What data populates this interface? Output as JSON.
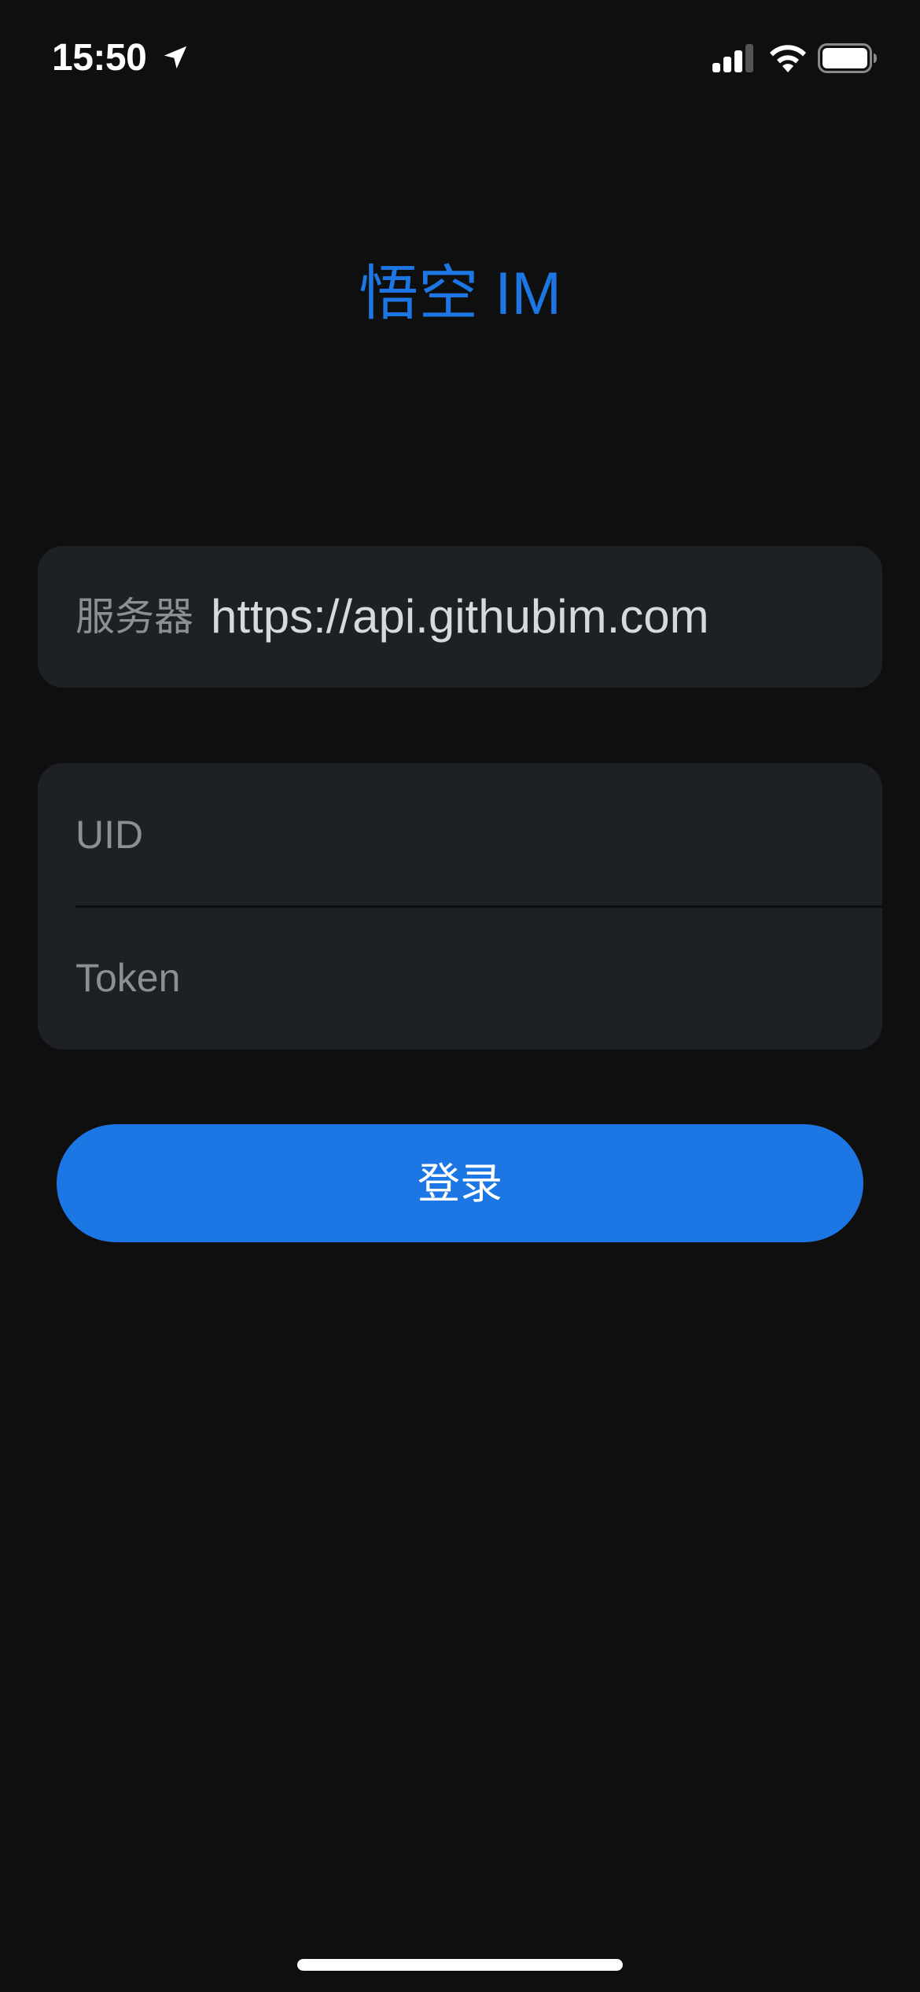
{
  "status_bar": {
    "time": "15:50",
    "icons": [
      "location-arrow-icon",
      "cellular-signal-icon",
      "wifi-icon",
      "battery-icon"
    ]
  },
  "app": {
    "title": "悟空 IM"
  },
  "server": {
    "label": "服务器",
    "value": "https://api.githubim.com"
  },
  "credentials": {
    "uid_placeholder": "UID",
    "token_placeholder": "Token"
  },
  "login": {
    "label": "登录"
  },
  "colors": {
    "background": "#0f0f10",
    "card": "#1d2024",
    "accent": "#1c77e4",
    "placeholder": "#8e8f93"
  }
}
